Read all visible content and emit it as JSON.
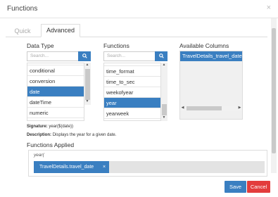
{
  "dialog": {
    "title": "Functions",
    "close_icon": "close-icon"
  },
  "tabs": [
    {
      "label": "Quick"
    },
    {
      "label": "Advanced"
    }
  ],
  "data_type": {
    "label": "Data Type",
    "search_placeholder": "Search...",
    "items": [
      "",
      "conditional",
      "conversion",
      "date",
      "dateTime",
      "numeric"
    ],
    "selected": "date"
  },
  "functions": {
    "label": "Functions",
    "search_placeholder": "Search...",
    "items": [
      "",
      "time_format",
      "time_to_sec",
      "weekofyear",
      "year",
      "yearweek"
    ],
    "selected": "year"
  },
  "available_columns": {
    "label": "Available Columns",
    "items": [
      "TravelDetails_travel_date"
    ]
  },
  "signature": {
    "label": "Signature:",
    "value": "year($(date))"
  },
  "description": {
    "label": "Description:",
    "value": "Displays the year for a given date."
  },
  "functions_applied": {
    "label": "Functions Applied",
    "expression": "year(",
    "chip": "TravelDetails.travel_date",
    "chip_close": "×"
  },
  "footer": {
    "save": "Save",
    "cancel": "Cancel"
  },
  "colors": {
    "primary": "#3a7fc1",
    "danger": "#e33d3d"
  }
}
